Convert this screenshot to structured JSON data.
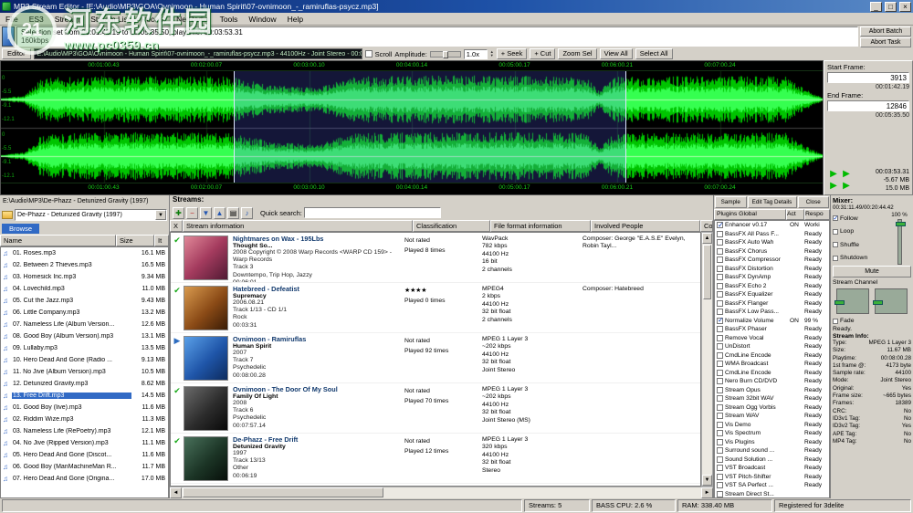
{
  "watermark": {
    "badge": "21",
    "site": "河东软件园",
    "url": "www.pc0359.cn"
  },
  "titlebar": {
    "title": "MP3 Stream Editor - [E:\\Audio\\MP3\\GOA\\Ovnimoon - Human Spirit\\07-ovnimoon_-_ramiruflas-psycz.mp3]",
    "min_glyph": "_",
    "max_glyph": "□",
    "close_glyph": "×"
  },
  "menubar": {
    "items": [
      "File",
      "ES3",
      "Stream",
      "Stream List",
      "Recent",
      "NetRadio",
      "Tools",
      "Window",
      "Help"
    ]
  },
  "infobar": {
    "icon_glyph": "i",
    "line1": "Selection set from 00:01:42.19 to 00:05:35.50, playtime: 00:03:53.31",
    "line2": "160kbps",
    "abort_batch": "Abort Batch",
    "abort_task": "Abort Task"
  },
  "editorbar": {
    "tab": "Editor",
    "path": "E:\\Audio\\MP3\\GOA\\Ovnimoon - Human Spirit\\07-ovnimoon_-_ramiruflas-psycz.mp3 - 44100Hz - Joint Stereo - 00:08:00.28",
    "scroll": "Scroll",
    "amplitude": "Amplitude:",
    "speed": "1.0x",
    "buttons": [
      "+ Seek",
      "+ Cut",
      "Zoom Sel",
      "View All",
      "Select All"
    ]
  },
  "waveform": {
    "ruler": [
      "00:01:00.43",
      "00:02:00.07",
      "00:03:00.10",
      "00:04:00.14",
      "00:05:00.17",
      "00:06:00.21",
      "00:07:00.24"
    ],
    "scale": [
      "0",
      "-5.5",
      "-9.1",
      "-12.1"
    ]
  },
  "sidepanel": {
    "start_frame_label": "Start Frame:",
    "start_frame": "3913",
    "start_time": "00:01:42.19",
    "end_frame_label": "End Frame:",
    "end_frame": "12846",
    "end_time": "00:05:35.50",
    "play_glyph": "▶",
    "sel_length": "00:03:53.31",
    "size_cut": "-5.67 MB",
    "size_total": "15.0 MB"
  },
  "browser": {
    "path": "E:\\Audio\\MP3\\De-Phazz - Detunized Gravity (1997)",
    "combo": "De-Phazz - Detunized Gravity (1997)",
    "combo_arrow": "▼",
    "tab": "Browse",
    "columns": [
      "Name",
      "Size",
      "It"
    ],
    "note_glyph": "♫",
    "files": [
      {
        "name": "01. Roses.mp3",
        "size": "16.1 MB",
        "cls": ""
      },
      {
        "name": "02. Between 2 Thieves.mp3",
        "size": "16.5 MB",
        "cls": ""
      },
      {
        "name": "03. Homesick Inc.mp3",
        "size": "9.34 MB",
        "cls": ""
      },
      {
        "name": "04. Lovechild.mp3",
        "size": "11.0 MB",
        "cls": ""
      },
      {
        "name": "05. Cut the Jazz.mp3",
        "size": "9.43 MB",
        "cls": ""
      },
      {
        "name": "06. Little Company.mp3",
        "size": "13.2 MB",
        "cls": ""
      },
      {
        "name": "07. Nameless Life (Album Version...",
        "size": "12.6 MB",
        "cls": ""
      },
      {
        "name": "08. Good Boy (Album Version).mp3",
        "size": "13.1 MB",
        "cls": ""
      },
      {
        "name": "09. Lullaby.mp3",
        "size": "13.5 MB",
        "cls": ""
      },
      {
        "name": "10. Hero Dead And Gone (Radio ...",
        "size": "9.13 MB",
        "cls": ""
      },
      {
        "name": "11. No Jive (Album Version).mp3",
        "size": "10.5 MB",
        "cls": ""
      },
      {
        "name": "12. Detunized Gravity.mp3",
        "size": "8.62 MB",
        "cls": ""
      },
      {
        "name": "13. Free Drift.mp3",
        "size": "14.5 MB",
        "cls": "selected"
      },
      {
        "name": "01. Good Boy (live).mp3",
        "size": "11.6 MB",
        "cls": ""
      },
      {
        "name": "02. Riddim Wize.mp3",
        "size": "11.3 MB",
        "cls": ""
      },
      {
        "name": "03. Nameless Life (RePoetry).mp3",
        "size": "12.1 MB",
        "cls": ""
      },
      {
        "name": "04. No Jive (Ripped Version).mp3",
        "size": "11.1 MB",
        "cls": ""
      },
      {
        "name": "05. Hero Dead And Gone (Discot...",
        "size": "11.6 MB",
        "cls": ""
      },
      {
        "name": "06. Good Boy (ManMachineMan R...",
        "size": "11.7 MB",
        "cls": ""
      },
      {
        "name": "07. Hero Dead And Gone (Origina...",
        "size": "17.0 MB",
        "cls": ""
      }
    ]
  },
  "streams": {
    "label": "Streams:",
    "icons": [
      "✚",
      "−",
      "▼",
      "▲",
      "▤",
      "♪"
    ],
    "quick_search": "Quick search:",
    "columns": [
      "X",
      "Stream information",
      "Classification",
      "File format information",
      "Involved People",
      "Comm"
    ],
    "rows": [
      {
        "marker": "check",
        "art": "art1",
        "title": "Nightmares on Wax - 195Lbs",
        "album": "Thought So...",
        "details": "2008 Copyright © 2008 Warp Records <WARP CD 159> - Warp Records\nTrack 3\nDowntempo, Trip Hop, Jazzy\n00:06:01",
        "classification": "Not rated\nPlayed 8 times",
        "format": "WavPack\n782 kbps\n44100 Hz\n16 bit\n2 channels",
        "people": "Composer: George \"E.A.S.E\" Evelyn, Robin Tayl..."
      },
      {
        "marker": "check",
        "art": "art2",
        "title": "Hatebreed - Defeatist",
        "album": "Supremacy",
        "details": "2006.08.21\nTrack 1/13 - CD 1/1\nRock\n00:03:31",
        "classification": "★★★★\nPlayed 0 times",
        "format": "MPEG4\n2 kbps\n44100 Hz\n32 bit float\n2 channels",
        "people": "Composer: Hatebreed"
      },
      {
        "marker": "play",
        "art": "art3",
        "title": "Ovnimoon - Ramiruflas",
        "album": "Human Spirit",
        "details": "2007\nTrack 7\nPsychedelic\n00:08:00.28",
        "classification": "Not rated\nPlayed 92 times",
        "format": "MPEG 1 Layer 3\n~202 kbps\n44100 Hz\n32 bit float\nJoint Stereo",
        "people": ""
      },
      {
        "marker": "check",
        "art": "art4",
        "title": "Ovnimoon - The Door Of My Soul",
        "album": "Family Of Light",
        "details": "2008\nTrack 6\nPsychedelic\n00:07:57.14",
        "classification": "Not rated\nPlayed 70 times",
        "format": "MPEG 1 Layer 3\n~202 kbps\n44100 Hz\n32 bit float\nJoint Stereo (MS)",
        "people": ""
      },
      {
        "marker": "check",
        "art": "art5",
        "title": "De-Phazz - Free Drift",
        "album": "Detunized Gravity",
        "details": "1997\nTrack 13/13\nOther\n00:06:19",
        "classification": "Not rated\nPlayed 12 times",
        "format": "MPEG 1 Layer 3\n320 kbps\n44100 Hz\n32 bit float\nStereo",
        "people": ""
      }
    ]
  },
  "plugins": {
    "sample": "Sample",
    "edit_tag": "Edit Tag Details",
    "close": "Close",
    "header": "Plugins Global",
    "col_act": "Act",
    "col_resp": "Respo",
    "items": [
      {
        "name": "Enhancer v0.17",
        "act": "ON",
        "resp": "Worki",
        "cls": "checked"
      },
      {
        "name": "BassFX All Pass F...",
        "act": "",
        "resp": "Ready",
        "cls": ""
      },
      {
        "name": "BassFX Auto Wah",
        "act": "",
        "resp": "Ready",
        "cls": ""
      },
      {
        "name": "BassFX Chorus",
        "act": "",
        "resp": "Ready",
        "cls": ""
      },
      {
        "name": "BassFX Compressor",
        "act": "",
        "resp": "Ready",
        "cls": ""
      },
      {
        "name": "BassFX Distortion",
        "act": "",
        "resp": "Ready",
        "cls": ""
      },
      {
        "name": "BassFX DynAmp",
        "act": "",
        "resp": "Ready",
        "cls": ""
      },
      {
        "name": "BassFX Echo 2",
        "act": "",
        "resp": "Ready",
        "cls": ""
      },
      {
        "name": "BassFX Equalizer",
        "act": "",
        "resp": "Ready",
        "cls": ""
      },
      {
        "name": "BassFX Flanger",
        "act": "",
        "resp": "Ready",
        "cls": ""
      },
      {
        "name": "BassFX Low Pass...",
        "act": "",
        "resp": "Ready",
        "cls": ""
      },
      {
        "name": "Normalize Volume",
        "act": "ON",
        "resp": "99 %",
        "cls": "checked"
      },
      {
        "name": "BassFX Phaser",
        "act": "",
        "resp": "Ready",
        "cls": ""
      },
      {
        "name": "Remove Vocal",
        "act": "",
        "resp": "Ready",
        "cls": ""
      },
      {
        "name": "UnDistort",
        "act": "",
        "resp": "Ready",
        "cls": ""
      },
      {
        "name": "CmdLine Encode",
        "act": "",
        "resp": "Ready",
        "cls": ""
      },
      {
        "name": "WMA Broadcast",
        "act": "",
        "resp": "Ready",
        "cls": ""
      },
      {
        "name": "CmdLine Encode",
        "act": "",
        "resp": "Ready",
        "cls": ""
      },
      {
        "name": "Nero Burn CD/DVD",
        "act": "",
        "resp": "Ready",
        "cls": ""
      },
      {
        "name": "Stream Opus",
        "act": "",
        "resp": "Ready",
        "cls": ""
      },
      {
        "name": "Stream 32bit WAV",
        "act": "",
        "resp": "Ready",
        "cls": ""
      },
      {
        "name": "Stream Ogg Vorbis",
        "act": "",
        "resp": "Ready",
        "cls": ""
      },
      {
        "name": "Stream WAV",
        "act": "",
        "resp": "Ready",
        "cls": ""
      },
      {
        "name": "Vis Demo",
        "act": "",
        "resp": "Ready",
        "cls": ""
      },
      {
        "name": "Vis Spectrum",
        "act": "",
        "resp": "Ready",
        "cls": ""
      },
      {
        "name": "Vis Plugins",
        "act": "",
        "resp": "Ready",
        "cls": ""
      },
      {
        "name": "Surround sound ...",
        "act": "",
        "resp": "Ready",
        "cls": ""
      },
      {
        "name": "Sound Solution ...",
        "act": "",
        "resp": "Ready",
        "cls": ""
      },
      {
        "name": "VST Broadcast",
        "act": "",
        "resp": "Ready",
        "cls": ""
      },
      {
        "name": "VST Pitch-Shifter",
        "act": "",
        "resp": "Ready",
        "cls": ""
      },
      {
        "name": "VST SA Perfect ...",
        "act": "",
        "resp": "Ready",
        "cls": ""
      },
      {
        "name": "Stream Direct St...",
        "act": "",
        "resp": "",
        "cls": ""
      }
    ]
  },
  "mixer": {
    "label": "Mixer:",
    "time": "00:31:11.49/00:20:44.42",
    "volume": "100 %",
    "checks": [
      {
        "label": "Follow",
        "cls": "checked"
      },
      {
        "label": "Loop",
        "cls": ""
      },
      {
        "label": "Shuffle",
        "cls": ""
      },
      {
        "label": "Shutdown",
        "cls": ""
      }
    ],
    "mute": "Mute",
    "channel_header": "Stream Channel",
    "fade": "Fade",
    "ready": "Ready.",
    "info_header": "Stream Info:",
    "info": [
      {
        "k": "Type:",
        "v": "MPEG 1 Layer 3"
      },
      {
        "k": "Size:",
        "v": "11.67 MB"
      },
      {
        "k": "Playtime:",
        "v": "00:08:00.28"
      },
      {
        "k": "1st frame @:",
        "v": "4173 byte"
      },
      {
        "k": "Sample rate:",
        "v": "44100"
      },
      {
        "k": "Mode:",
        "v": "Joint Stereo"
      },
      {
        "k": "Original:",
        "v": "Yes"
      },
      {
        "k": "Frame size:",
        "v": "~665 bytes"
      },
      {
        "k": "Frames:",
        "v": "18389"
      },
      {
        "k": "CRC:",
        "v": "No"
      },
      {
        "k": "ID3v1 Tag:",
        "v": "No"
      },
      {
        "k": "ID3v2 Tag:",
        "v": "Yes"
      },
      {
        "k": "APE Tag:",
        "v": "No"
      },
      {
        "k": "MP4 Tag:",
        "v": "No"
      }
    ]
  },
  "statusbar": {
    "segments": [
      "",
      "Streams: 5",
      "BASS CPU: 2.6 %",
      "RAM: 338.40 MB",
      "Registered for 3delite"
    ]
  }
}
